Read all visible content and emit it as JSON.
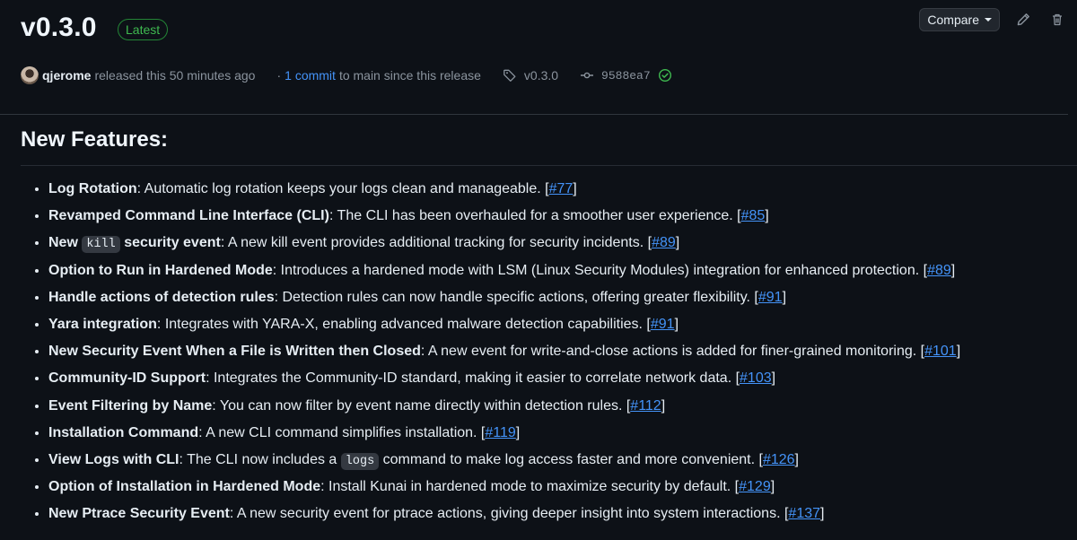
{
  "release": {
    "title": "v0.3.0",
    "badge": "Latest",
    "compare_label": "Compare",
    "author": "qjerome",
    "released_text": "released this 50 minutes ago",
    "commits_prefix": "·",
    "commits_link": "1 commit",
    "commits_suffix": "to main since this release",
    "tag": "v0.3.0",
    "commit_sha": "9588ea7"
  },
  "section": {
    "title": "New Features:"
  },
  "features": [
    {
      "bold": "Log Rotation",
      "text": ": Automatic log rotation keeps your logs clean and manageable. [",
      "ref": "#77"
    },
    {
      "bold": "Revamped Command Line Interface (CLI)",
      "text": ": The CLI has been overhauled for a smoother user experience. [",
      "ref": "#85"
    },
    {
      "bold_pre": "New",
      "code": "kill",
      "bold_post": "security event",
      "text": ": A new kill event provides additional tracking for security incidents. [",
      "ref": "#89"
    },
    {
      "bold": "Option to Run in Hardened Mode",
      "text": ": Introduces a hardened mode with LSM (Linux Security Modules) integration for enhanced protection. [",
      "ref": "#89"
    },
    {
      "bold": "Handle actions of detection rules",
      "text": ": Detection rules can now handle specific actions, offering greater flexibility. [",
      "ref": "#91"
    },
    {
      "bold": "Yara integration",
      "text": ": Integrates with YARA-X, enabling advanced malware detection capabilities. [",
      "ref": "#91"
    },
    {
      "bold": "New Security Event When a File is Written then Closed",
      "text": ": A new event for write-and-close actions is added for finer-grained monitoring. [",
      "ref": "#101"
    },
    {
      "bold": "Community-ID Support",
      "text": ": Integrates the Community-ID standard, making it easier to correlate network data. [",
      "ref": "#103"
    },
    {
      "bold": "Event Filtering by Name",
      "text": ": You can now filter by event name directly within detection rules. [",
      "ref": "#112"
    },
    {
      "bold": "Installation Command",
      "text": ": A new CLI command simplifies installation. [",
      "ref": "#119"
    },
    {
      "bold": "View Logs with CLI",
      "text_pre": ": The CLI now includes a",
      "code": "logs",
      "text": "command to make log access faster and more convenient. [",
      "ref": "#126"
    },
    {
      "bold": "Option of Installation in Hardened Mode",
      "text": ": Install Kunai in hardened mode to maximize security by default. [",
      "ref": "#129"
    },
    {
      "bold": "New Ptrace Security Event",
      "text": ": A new security event for ptrace actions, giving deeper insight into system interactions. [",
      "ref": "#137"
    }
  ],
  "icons": {
    "edit": "pencil-icon",
    "delete": "trash-icon",
    "tag": "tag-icon",
    "commit": "git-commit-icon",
    "verified": "check-circle-icon"
  },
  "colors": {
    "link": "#4493f8",
    "badge": "#3fb950",
    "background": "#0d1117"
  }
}
